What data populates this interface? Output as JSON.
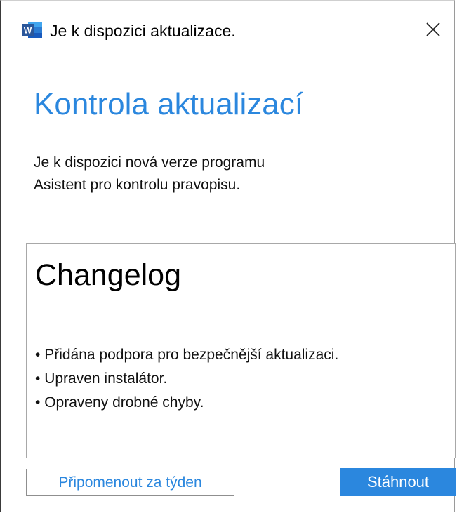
{
  "window": {
    "title": "Je k dispozici aktualizace.",
    "app_icon": "word-app-icon",
    "close_icon": "close-icon"
  },
  "heading": "Kontrola aktualizací",
  "message": {
    "line1": "Je k dispozici nová verze programu",
    "line2": "Asistent pro kontrolu pravopisu."
  },
  "changelog": {
    "title": "Changelog",
    "items": [
      "Přidána podpora pro bezpečnější aktualizaci.",
      "Upraven instalátor.",
      "Opraveny drobné chyby."
    ]
  },
  "buttons": {
    "remind_label": "Připomenout za týden",
    "download_label": "Stáhnout"
  },
  "colors": {
    "accent": "#2b87de",
    "word_blue": "#2b579a"
  }
}
